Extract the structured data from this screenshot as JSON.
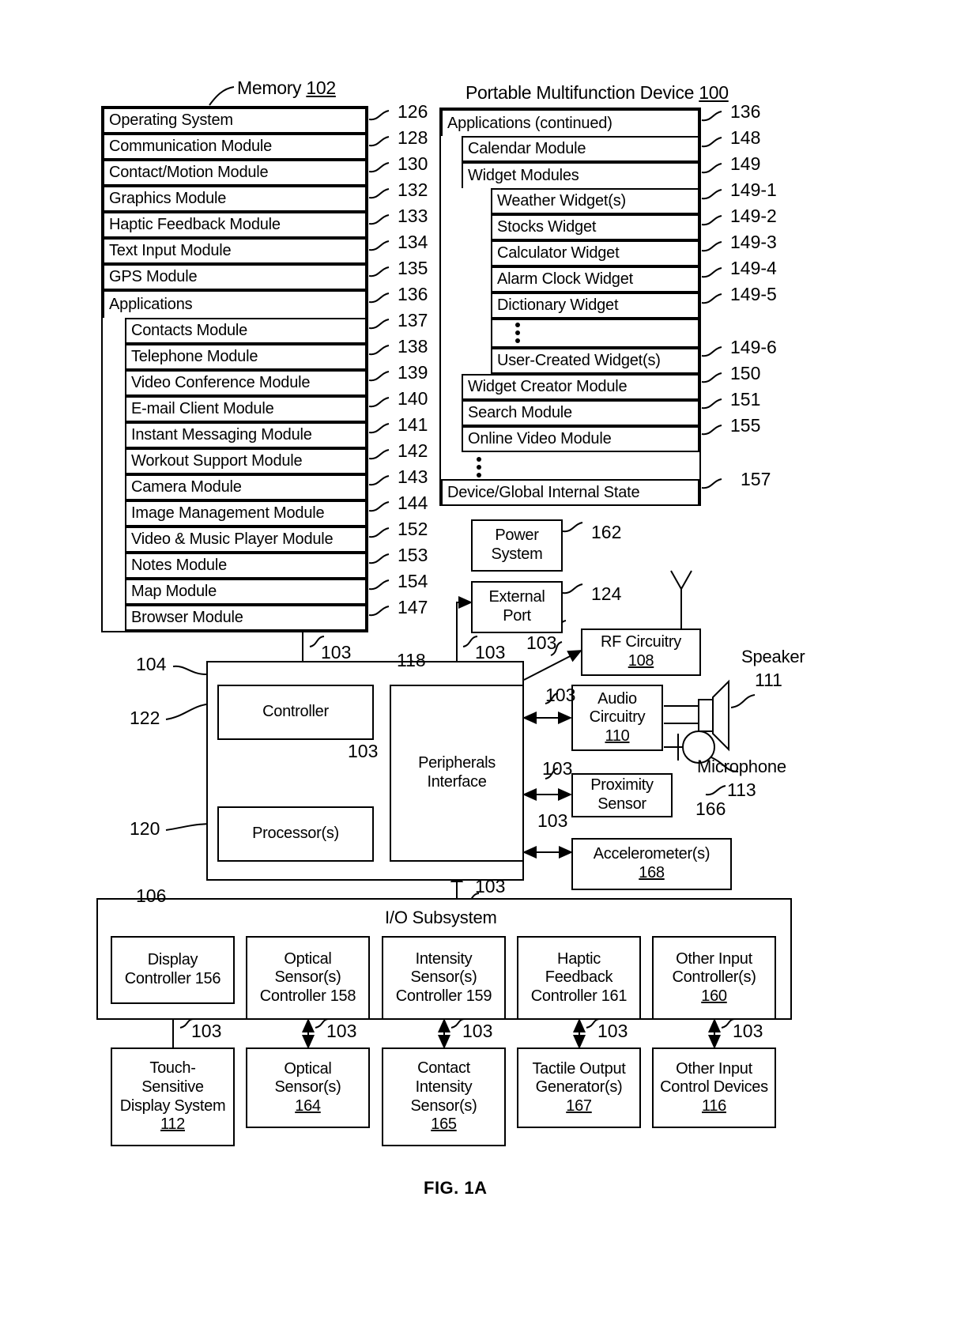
{
  "figure": {
    "caption": "FIG. 1A",
    "memory_title": "Memory",
    "memory_ref": "102",
    "device_title": "Portable Multifunction Device",
    "device_ref": "100"
  },
  "memory_column": {
    "items": [
      {
        "label": "Operating System",
        "ref": "126",
        "indent": 0
      },
      {
        "label": "Communication Module",
        "ref": "128",
        "indent": 0
      },
      {
        "label": "Contact/Motion Module",
        "ref": "130",
        "indent": 0
      },
      {
        "label": "Graphics Module",
        "ref": "132",
        "indent": 0
      },
      {
        "label": "Haptic Feedback Module",
        "ref": "133",
        "indent": 0
      },
      {
        "label": "Text Input Module",
        "ref": "134",
        "indent": 0
      },
      {
        "label": "GPS Module",
        "ref": "135",
        "indent": 0
      },
      {
        "label": "Applications",
        "ref": "136",
        "indent": 0
      },
      {
        "label": "Contacts Module",
        "ref": "137",
        "indent": 1
      },
      {
        "label": "Telephone Module",
        "ref": "138",
        "indent": 1
      },
      {
        "label": "Video Conference Module",
        "ref": "139",
        "indent": 1
      },
      {
        "label": "E-mail Client Module",
        "ref": "140",
        "indent": 1
      },
      {
        "label": "Instant Messaging Module",
        "ref": "141",
        "indent": 1
      },
      {
        "label": "Workout Support Module",
        "ref": "142",
        "indent": 1
      },
      {
        "label": "Camera Module",
        "ref": "143",
        "indent": 1
      },
      {
        "label": "Image Management Module",
        "ref": "144",
        "indent": 1
      },
      {
        "label": "Video & Music Player Module",
        "ref": "152",
        "indent": 1
      },
      {
        "label": "Notes Module",
        "ref": "153",
        "indent": 1
      },
      {
        "label": "Map Module",
        "ref": "154",
        "indent": 1
      },
      {
        "label": "Browser Module",
        "ref": "147",
        "indent": 1
      }
    ]
  },
  "applications_column": {
    "items": [
      {
        "label": "Applications (continued)",
        "ref": "136",
        "indent": 0
      },
      {
        "label": "Calendar Module",
        "ref": "148",
        "indent": 1
      },
      {
        "label": "Widget Modules",
        "ref": "149",
        "indent": 1
      },
      {
        "label": "Weather Widget(s)",
        "ref": "149-1",
        "indent": 2
      },
      {
        "label": "Stocks Widget",
        "ref": "149-2",
        "indent": 2
      },
      {
        "label": "Calculator Widget",
        "ref": "149-3",
        "indent": 2
      },
      {
        "label": "Alarm Clock Widget",
        "ref": "149-4",
        "indent": 2
      },
      {
        "label": "Dictionary Widget",
        "ref": "149-5",
        "indent": 2
      },
      {
        "label": "",
        "ref": "",
        "indent": 2,
        "ellipsis": true
      },
      {
        "label": "User-Created Widget(s)",
        "ref": "149-6",
        "indent": 2
      },
      {
        "label": "Widget Creator Module",
        "ref": "150",
        "indent": 1
      },
      {
        "label": "Search Module",
        "ref": "151",
        "indent": 1
      },
      {
        "label": "Online Video Module",
        "ref": "155",
        "indent": 1
      },
      {
        "label": "",
        "ref": "",
        "indent": 1,
        "ellipsis": true
      },
      {
        "label": "Device/Global Internal State",
        "ref": "157",
        "indent": 0
      }
    ]
  },
  "side_blocks": {
    "power_system": {
      "line1": "Power",
      "line2": "System",
      "ref": "162"
    },
    "external_port": {
      "line1": "External",
      "line2": "Port",
      "ref": "124"
    },
    "rf_circuitry": {
      "label": "RF Circuitry",
      "ref": "108"
    },
    "audio_circuitry": {
      "line1": "Audio",
      "line2": "Circuitry",
      "ref": "110"
    },
    "proximity_sensor": {
      "line1": "Proximity",
      "line2": "Sensor",
      "ref": "166"
    },
    "accelerometer": {
      "label": "Accelerometer(s)",
      "ref": "168"
    },
    "speaker": {
      "label": "Speaker",
      "ref": "111"
    },
    "microphone": {
      "label": "Microphone",
      "ref": "113"
    }
  },
  "core": {
    "cpu_group_ref": "104",
    "controller": {
      "label": "Controller",
      "ref": "122"
    },
    "processor": {
      "label": "Processor(s)",
      "ref": "120"
    },
    "peripherals": {
      "line1": "Peripherals",
      "line2": "Interface",
      "ref": "118"
    },
    "bus_ref": "103"
  },
  "io_subsystem": {
    "title": "I/O Subsystem",
    "ref": "106",
    "controllers": [
      {
        "lines": [
          "Display",
          "Controller 156"
        ],
        "ref": "156"
      },
      {
        "lines": [
          "Optical",
          "Sensor(s)",
          "Controller 158"
        ],
        "ref": "158"
      },
      {
        "lines": [
          "Intensity",
          "Sensor(s)",
          "Controller 159"
        ],
        "ref": "159"
      },
      {
        "lines": [
          "Haptic",
          "Feedback",
          "Controller 161"
        ],
        "ref": "161"
      },
      {
        "lines": [
          "Other Input",
          "Controller(s)",
          "160"
        ],
        "ref": "160"
      }
    ],
    "devices": [
      {
        "lines": [
          "Touch-",
          "Sensitive",
          "Display System",
          "112"
        ],
        "ref": "112"
      },
      {
        "lines": [
          "Optical",
          "Sensor(s)",
          "164"
        ],
        "ref": "164"
      },
      {
        "lines": [
          "Contact",
          "Intensity",
          "Sensor(s)",
          "165"
        ],
        "ref": "165"
      },
      {
        "lines": [
          "Tactile Output",
          "Generator(s)",
          "167"
        ],
        "ref": "167"
      },
      {
        "lines": [
          "Other Input",
          "Control Devices",
          "116"
        ],
        "ref": "116"
      }
    ],
    "link_ref": "103"
  }
}
